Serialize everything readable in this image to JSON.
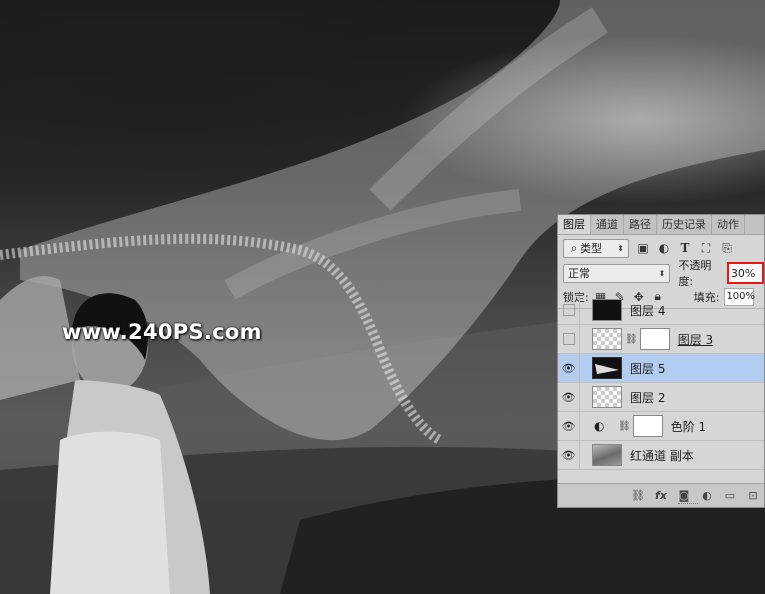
{
  "watermark": "www.240PS.com",
  "panel": {
    "tabs": [
      "图层",
      "通道",
      "路径",
      "历史记录",
      "动作"
    ],
    "filter_select": "类型",
    "blend_mode": "正常",
    "opacity_label": "不透明度:",
    "opacity_value": "30%",
    "lock_label": "锁定:",
    "fill_label": "填充:",
    "fill_value": "100%",
    "layers": [
      {
        "name": "图层 4",
        "visible": false
      },
      {
        "name": "图层 3",
        "visible": false
      },
      {
        "name": "图层 5",
        "visible": true,
        "selected": true
      },
      {
        "name": "图层 2",
        "visible": true
      },
      {
        "name": "色阶 1",
        "visible": true
      },
      {
        "name": "红通道 副本",
        "visible": true
      }
    ],
    "bottom_icons": [
      "link-icon",
      "fx-icon",
      "add-mask-icon",
      "adjustment-icon",
      "folder-icon",
      "new-layer-icon"
    ]
  },
  "colors": {
    "highlight": "#e11111",
    "selected_row": "#b3cdf0",
    "panel_bg": "#d6d6d6"
  }
}
